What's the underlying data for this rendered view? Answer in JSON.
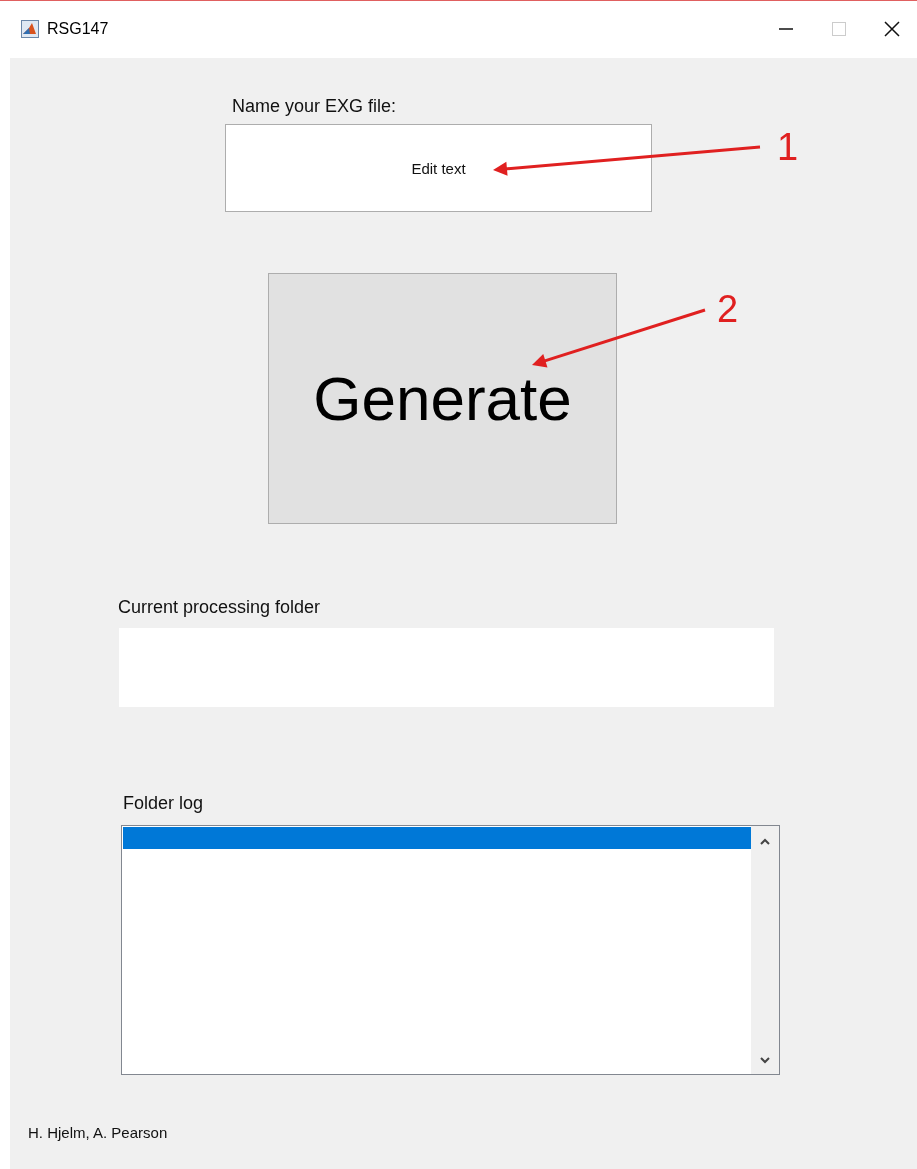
{
  "window": {
    "title": "RSG147"
  },
  "name_field": {
    "label": "Name your EXG file:",
    "value": "Edit text"
  },
  "generate_button": {
    "label": "Generate"
  },
  "current_folder": {
    "label": "Current processing folder"
  },
  "folder_log": {
    "label": "Folder log",
    "items": [
      {
        "selected": true
      }
    ]
  },
  "credits": "H. Hjelm, A. Pearson",
  "annotations": [
    {
      "label": "1"
    },
    {
      "label": "2"
    }
  ]
}
